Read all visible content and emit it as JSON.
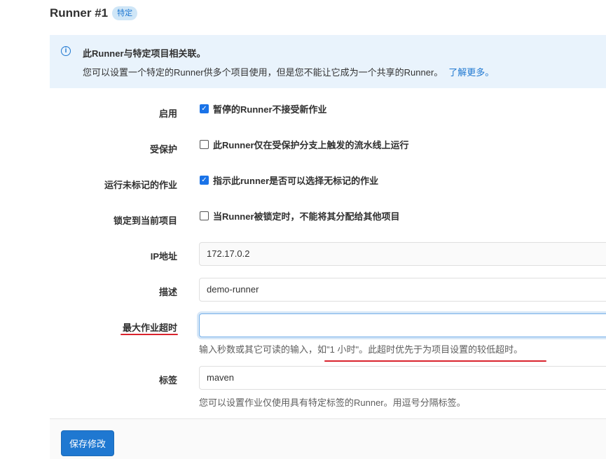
{
  "header": {
    "title": "Runner #1",
    "badge": "特定"
  },
  "info": {
    "title": "此Runner与特定项目相关联。",
    "text": "您可以设置一个特定的Runner供多个项目使用，但是您不能让它成为一个共享的Runner。",
    "link": "了解更多。"
  },
  "form": {
    "active": {
      "label": "启用",
      "checkbox_label": "暂停的Runner不接受新作业",
      "checked": true
    },
    "protected": {
      "label": "受保护",
      "checkbox_label": "此Runner仅在受保护分支上触发的流水线上运行",
      "checked": false
    },
    "run_untagged": {
      "label": "运行未标记的作业",
      "checkbox_label": "指示此runner是否可以选择无标记的作业",
      "checked": true
    },
    "locked": {
      "label": "锁定到当前项目",
      "checkbox_label": "当Runner被锁定时，不能将其分配给其他项目",
      "checked": false
    },
    "ip": {
      "label": "IP地址",
      "value": "172.17.0.2"
    },
    "description": {
      "label": "描述",
      "value": "demo-runner"
    },
    "max_timeout": {
      "label": "最大作业超时",
      "value": "",
      "help": "输入秒数或其它可读的输入，如\"1 小时\"。此超时优先于为项目设置的较低超时。"
    },
    "tags": {
      "label": "标签",
      "value": "maven",
      "help": "您可以设置作业仅使用具有特定标签的Runner。用逗号分隔标签。"
    }
  },
  "footer": {
    "save_label": "保存修改"
  },
  "colors": {
    "accent": "#1f78d1",
    "annotation": "#d9232d",
    "info_bg": "#e9f3fc"
  }
}
